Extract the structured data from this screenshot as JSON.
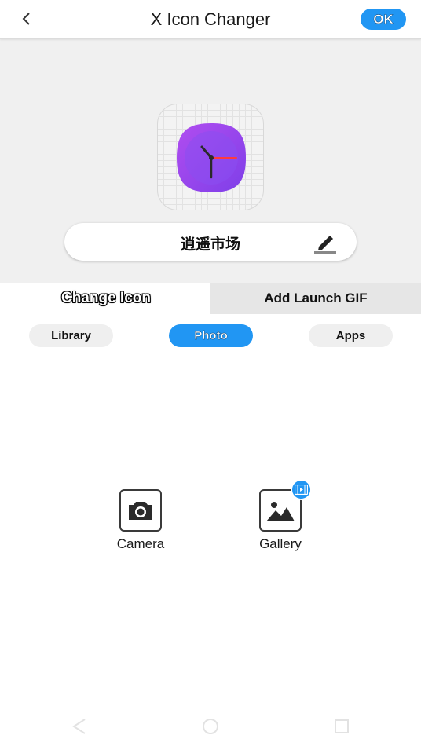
{
  "header": {
    "title": "X Icon Changer",
    "ok_label": "OK",
    "back_icon": "chevron-left-icon"
  },
  "preview": {
    "app_name": "逍遥市场",
    "app_icon": "clock-icon",
    "edit_icon": "pencil-icon"
  },
  "tabs": [
    {
      "label": "Change Icon",
      "active": true
    },
    {
      "label": "Add Launch GIF",
      "active": false
    }
  ],
  "sources": [
    {
      "label": "Library",
      "selected": false
    },
    {
      "label": "Photo",
      "selected": true
    },
    {
      "label": "Apps",
      "selected": false
    }
  ],
  "photo_options": [
    {
      "label": "Camera",
      "icon": "camera-icon"
    },
    {
      "label": "Gallery",
      "icon": "image-icon",
      "badge_icon": "video-icon"
    }
  ],
  "colors": {
    "accent": "#2196f3",
    "icon_purple": "#9b45e0",
    "preview_bg": "#f0f0f0"
  }
}
